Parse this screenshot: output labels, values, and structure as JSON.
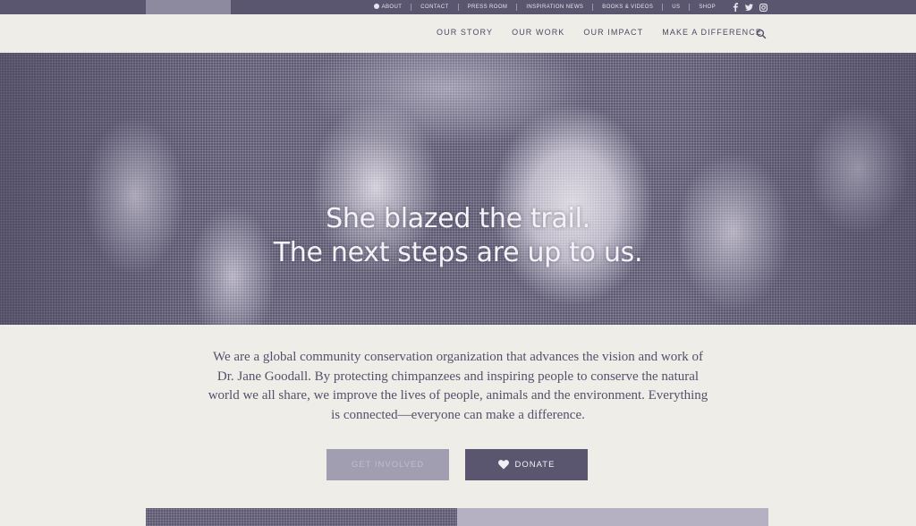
{
  "topbar": {
    "links": [
      {
        "label": "About",
        "icon": "globe-icon"
      },
      {
        "label": "Contact"
      },
      {
        "label": "Press Room"
      },
      {
        "label": "Inspiration News"
      },
      {
        "label": "Books & Videos"
      },
      {
        "label": "Us"
      },
      {
        "label": "Shop"
      }
    ],
    "social": [
      {
        "label": "f",
        "icon": "facebook-icon"
      },
      {
        "label": "t",
        "icon": "twitter-icon"
      },
      {
        "label": "ig",
        "icon": "instagram-icon"
      }
    ]
  },
  "nav": {
    "items": [
      "Our Story",
      "Our Work",
      "Our Impact",
      "Make a Difference"
    ],
    "search_icon": "search-icon"
  },
  "hero": {
    "line1": "She blazed the trail.",
    "line2": "The next steps are up to us."
  },
  "intro": {
    "text": "We are a global community conservation organization that advances the vision and work of Dr. Jane Goodall. By protecting chimpanzees and inspiring people to conserve the natural world we all share, we improve the lives of people, animals and the environment. Everything is connected—everyone can make a difference."
  },
  "buttons": {
    "secondary_label": "Get Involved",
    "donate_label": "Donate",
    "donate_icon": "heart-icon"
  },
  "colors": {
    "brand": "#5a5670",
    "background": "#efede8",
    "muted": "#a29eb1"
  }
}
